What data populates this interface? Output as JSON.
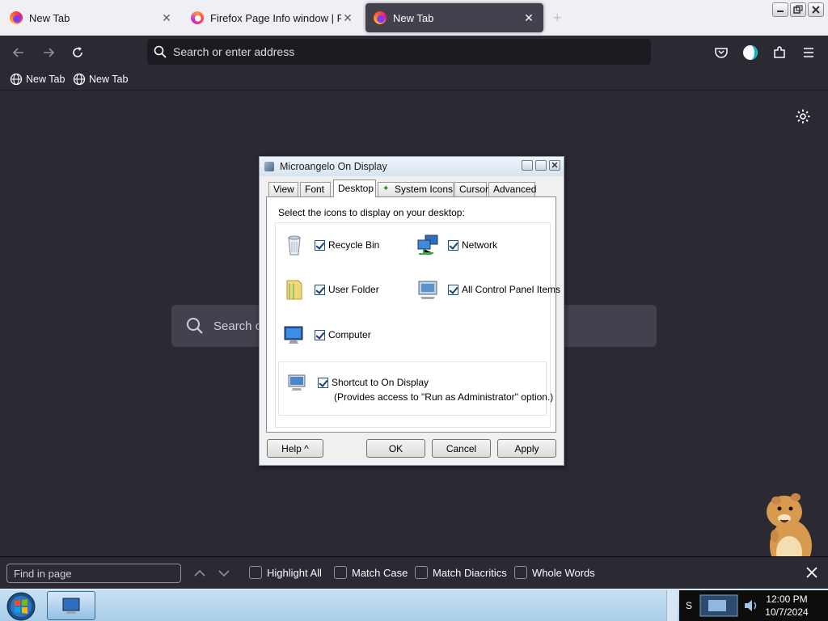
{
  "tabs": [
    {
      "title": "New Tab",
      "icon": "firefox-icon"
    },
    {
      "title": "Firefox Page Info window | Firef",
      "icon": "firefox-icon"
    },
    {
      "title": "New Tab",
      "icon": "firefox-icon"
    }
  ],
  "active_tab_index": 2,
  "navbar": {
    "url_placeholder": "Search or enter address"
  },
  "bookmarks": [
    {
      "label": "New Tab",
      "icon": "globe-icon"
    },
    {
      "label": "New Tab",
      "icon": "globe-icon"
    }
  ],
  "content": {
    "search_placeholder": "Search c"
  },
  "dialog": {
    "title": "Microangelo On Display",
    "tabs": [
      "View",
      "Font",
      "Desktop",
      "System Icons",
      "Cursor",
      "Advanced"
    ],
    "active_tab": "Desktop",
    "instruction": "Select the icons to display on your desktop:",
    "items": [
      {
        "label": "Recycle Bin",
        "checked": true,
        "icon": "recycle-bin-icon"
      },
      {
        "label": "Network",
        "checked": true,
        "icon": "network-icon"
      },
      {
        "label": "User Folder",
        "checked": true,
        "icon": "user-folder-icon"
      },
      {
        "label": "All Control Panel Items",
        "checked": true,
        "icon": "control-panel-icon"
      },
      {
        "label": "Computer",
        "checked": true,
        "icon": "computer-icon"
      }
    ],
    "shortcut": {
      "label": "Shortcut to On Display",
      "checked": true,
      "note": "(Provides access to \"Run as Administrator\" option.)"
    },
    "buttons": {
      "help": "Help ^",
      "ok": "OK",
      "cancel": "Cancel",
      "apply": "Apply"
    }
  },
  "findbar": {
    "placeholder": "Find in page",
    "options": [
      "Highlight All",
      "Match Case",
      "Match Diacritics",
      "Whole Words"
    ]
  },
  "taskbar": {
    "time": "12:00 PM",
    "date": "10/7/2024"
  },
  "colors": {
    "browser_bg": "#2b2a33",
    "tabstrip_bg": "#f0f0f4",
    "active_tab_bg": "#42414d",
    "taskbar_bg": "#a9cde9"
  }
}
